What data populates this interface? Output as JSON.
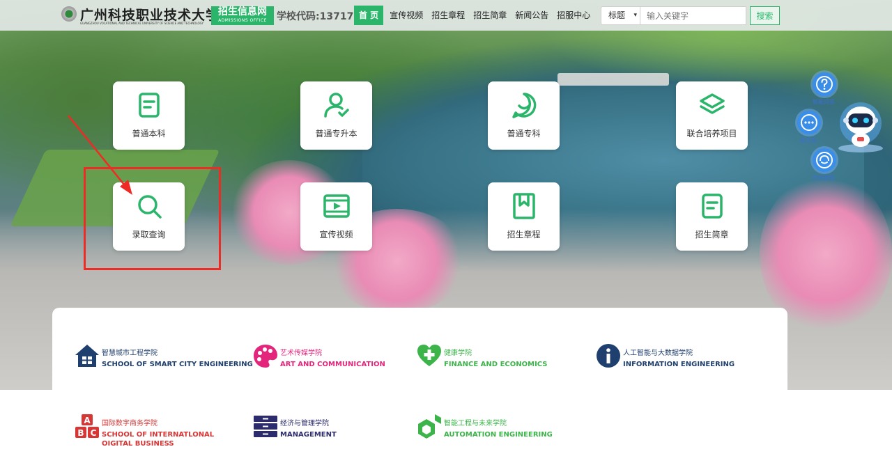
{
  "header": {
    "university_name": "广州科技职业技术大学",
    "university_subtitle": "GUANGZHOU VOCATIONAL AND TECHNICAL UNIVERSITY OF SCIENCE AND TECHNOLOGY",
    "admissions_title": "招生信息网",
    "admissions_subtitle": "ADMISSIONS OFFICE",
    "school_code": "学校代码:13717",
    "nav": [
      "首 页",
      "宣传视频",
      "招生章程",
      "招生简章",
      "新闻公告",
      "招服中心"
    ],
    "search_type": "标题",
    "search_placeholder": "输入关键字",
    "search_button": "搜索"
  },
  "tiles": [
    {
      "label": "普通本科",
      "icon": "document-icon"
    },
    {
      "label": "普通专升本",
      "icon": "user-check-icon"
    },
    {
      "label": "普通专科",
      "icon": "chat-smile-icon"
    },
    {
      "label": "联合培养项目",
      "icon": "layers-icon"
    },
    {
      "label": "录取查询",
      "icon": "search-icon"
    },
    {
      "label": "宣传视频",
      "icon": "video-icon"
    },
    {
      "label": "招生章程",
      "icon": "bookmark-book-icon"
    },
    {
      "label": "招生简章",
      "icon": "document-icon"
    }
  ],
  "side_widgets": [
    {
      "label": "智能问答",
      "icon": "question-icon"
    },
    {
      "label": "留言板",
      "icon": "more-dots-icon"
    },
    {
      "label": "在线客服",
      "icon": "service-icon"
    }
  ],
  "colleges": [
    {
      "cn": "智慧城市工程学院",
      "en": "SCHOOL OF SMART CITY ENGINEERING",
      "color": "#1f3f6e"
    },
    {
      "cn": "艺术传媒学院",
      "en": "ART AND COMMUNICATION",
      "color": "#e3257b"
    },
    {
      "cn": "健康学院",
      "en": "FINANCE AND ECONOMICS",
      "color": "#3cb44a"
    },
    {
      "cn": "人工智能与大数据学院",
      "en": "INFORMATION ENGINEERING",
      "color": "#1f3f6e"
    },
    {
      "cn": "国际数字商务学院",
      "en": "SCHOOL OF INTERNATLONAL OIGITAL BUSINESS",
      "color": "#d83535"
    },
    {
      "cn": "经济与管理学院",
      "en": "MANAGEMENT",
      "color": "#2b2b6e"
    },
    {
      "cn": "智能工程与未来学院",
      "en": "AUTOMATION ENGINEERING",
      "color": "#3cb44a"
    }
  ],
  "colors": {
    "accent": "#2bb56a",
    "highlight": "#ee2b24",
    "widget": "#3a8ee8"
  }
}
